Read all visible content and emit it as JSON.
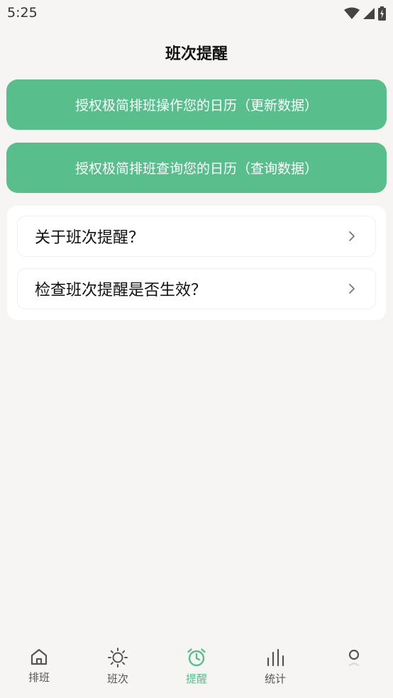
{
  "status_bar": {
    "time": "5:25"
  },
  "header": {
    "title": "班次提醒"
  },
  "actions": {
    "update_label": "授权极简排班操作您的日历（更新数据）",
    "query_label": "授权极简排班查询您的日历（查询数据）"
  },
  "list": {
    "items": [
      {
        "label": "关于班次提醒？"
      },
      {
        "label": "检查班次提醒是否生效？"
      }
    ]
  },
  "tabs": [
    {
      "label": "排班",
      "icon": "home-icon"
    },
    {
      "label": "班次",
      "icon": "sun-icon"
    },
    {
      "label": "提醒",
      "icon": "alarm-clock-icon",
      "active": true
    },
    {
      "label": "统计",
      "icon": "bar-chart-icon"
    },
    {
      "label": "",
      "icon": "profile-icon"
    }
  ],
  "colors": {
    "accent": "#57be8c",
    "background": "#f6f5f3",
    "card": "#ffffff",
    "text": "#111111",
    "tab_inactive": "#555555"
  }
}
